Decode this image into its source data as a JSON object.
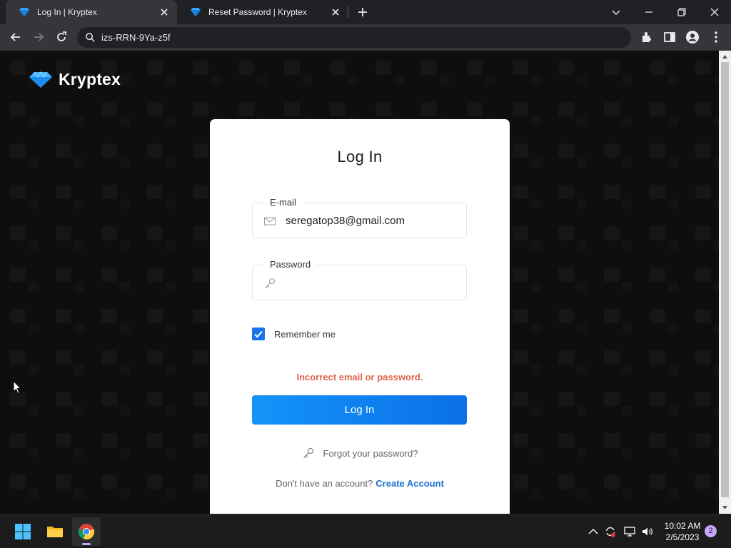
{
  "browser": {
    "tabs": [
      {
        "title": "Log In | Kryptex",
        "active": true
      },
      {
        "title": "Reset Password | Kryptex",
        "active": false
      }
    ],
    "address": "izs-RRN-9Ya-z5f"
  },
  "page": {
    "brand": "Kryptex",
    "card": {
      "title": "Log In",
      "email": {
        "label": "E-mail",
        "value": "seregatop38@gmail.com"
      },
      "password": {
        "label": "Password",
        "value": ""
      },
      "remember": {
        "label": "Remember me",
        "checked": true
      },
      "error": "Incorrect email or password.",
      "login_button": "Log In",
      "forgot": "Forgot your password?",
      "signup_prompt": "Don't have an account?",
      "signup_link": "Create Account"
    }
  },
  "taskbar": {
    "time": "10:02 AM",
    "date": "2/5/2023",
    "notifications": "2"
  },
  "colors": {
    "accent": "#1a73e8",
    "error": "#e0644c",
    "link": "#1a6fd0",
    "page_bg": "#0e0e0e"
  },
  "icons": [
    "diamond-favicon-icon",
    "close-icon",
    "plus-icon",
    "chevron-down-icon",
    "minimize-icon",
    "restore-icon",
    "back-icon",
    "forward-icon",
    "reload-icon",
    "search-icon",
    "extensions-icon",
    "sidepanel-icon",
    "profile-icon",
    "kebab-menu-icon",
    "envelope-icon",
    "key-icon",
    "checkmark-icon",
    "windows-start-icon",
    "file-explorer-icon",
    "chrome-icon",
    "chevron-up-icon",
    "sync-icon",
    "display-icon",
    "volume-icon"
  ]
}
